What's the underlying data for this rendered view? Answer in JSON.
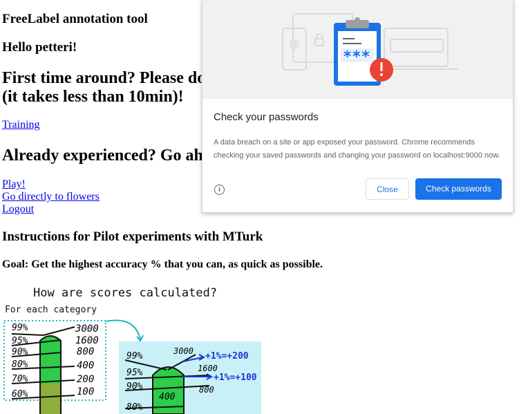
{
  "page": {
    "app_title": "FreeLabel annotation tool",
    "hello": "Hello petteri!",
    "first_time": "First time around? Please do",
    "first_time_line2": "(it takes less than 10min)!",
    "training_link": "Training",
    "experienced": "Already experienced? Go ah",
    "links": [
      "Play!",
      "Go directly to flowers",
      "Logout"
    ],
    "instructions_title": "Instructions for Pilot experiments with MTurk",
    "goal": "Goal: Get the highest accuracy % that you can, as quick as possible."
  },
  "scores_figure": {
    "heading": "How are scores calculated?",
    "subheading": "For each category",
    "left_pct": [
      "99%",
      "95%",
      "90%",
      "80%",
      "70%",
      "60%"
    ],
    "left_pts": [
      "3000",
      "1600",
      "800",
      "400",
      "200",
      "100"
    ],
    "right_pct": [
      "99%",
      "95%",
      "90%",
      "80%"
    ],
    "right_pts": [
      "3000",
      "1600",
      "800",
      "400"
    ],
    "right_annotations": [
      "+1%=+200",
      "+1%=+100"
    ]
  },
  "popup": {
    "title": "Check your passwords",
    "body": "A data breach on a site or app exposed your password. Chrome recommends checking your saved passwords and changing your password on localhost:9000 now.",
    "close_label": "Close",
    "check_label": "Check passwords",
    "password_mask": "***",
    "colors": {
      "accent": "#1a73e8",
      "alert": "#ea4335"
    }
  }
}
